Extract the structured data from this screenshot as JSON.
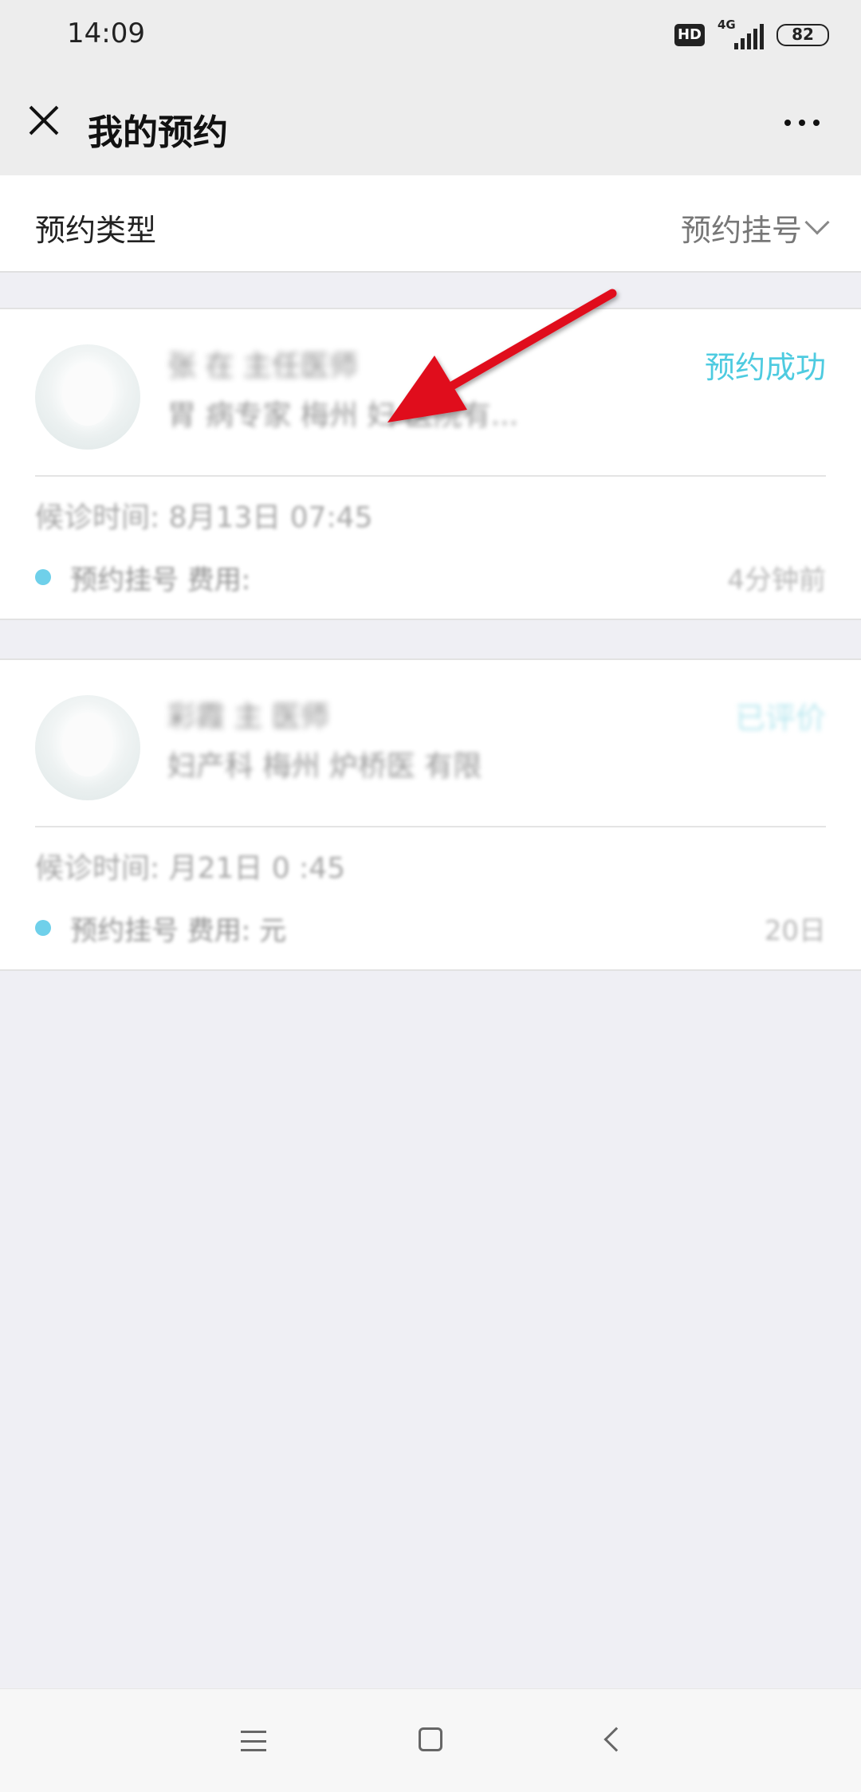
{
  "status_bar": {
    "time": "14:09",
    "hd": "HD",
    "network": "4G",
    "battery": "82"
  },
  "header": {
    "title": "我的预约"
  },
  "filter": {
    "label": "预约类型",
    "value": "预约挂号"
  },
  "appointments": [
    {
      "doctor": "张  在  主任医师",
      "desc": "胃    病专家  梅州  妇  医院有...",
      "status": "预约成功",
      "visit_time": "候诊时间: 8月13日 07:45",
      "fee": "预约挂号 费用:",
      "created": "4分钟前"
    },
    {
      "doctor": "  彩霞    主  医师",
      "desc": "妇产科      梅州  炉桥医  有限",
      "status": "已评价",
      "visit_time": "候诊时间:  月21日 0 :45",
      "fee": "预约挂号 费用:    元",
      "created": "   20日"
    }
  ],
  "colors": {
    "accent": "#4ecbe0",
    "arrow": "#e0101f",
    "background": "#efeff4"
  },
  "icons": {
    "close": "close-icon",
    "more": "more-icon",
    "chevron": "chevron-down-icon"
  }
}
